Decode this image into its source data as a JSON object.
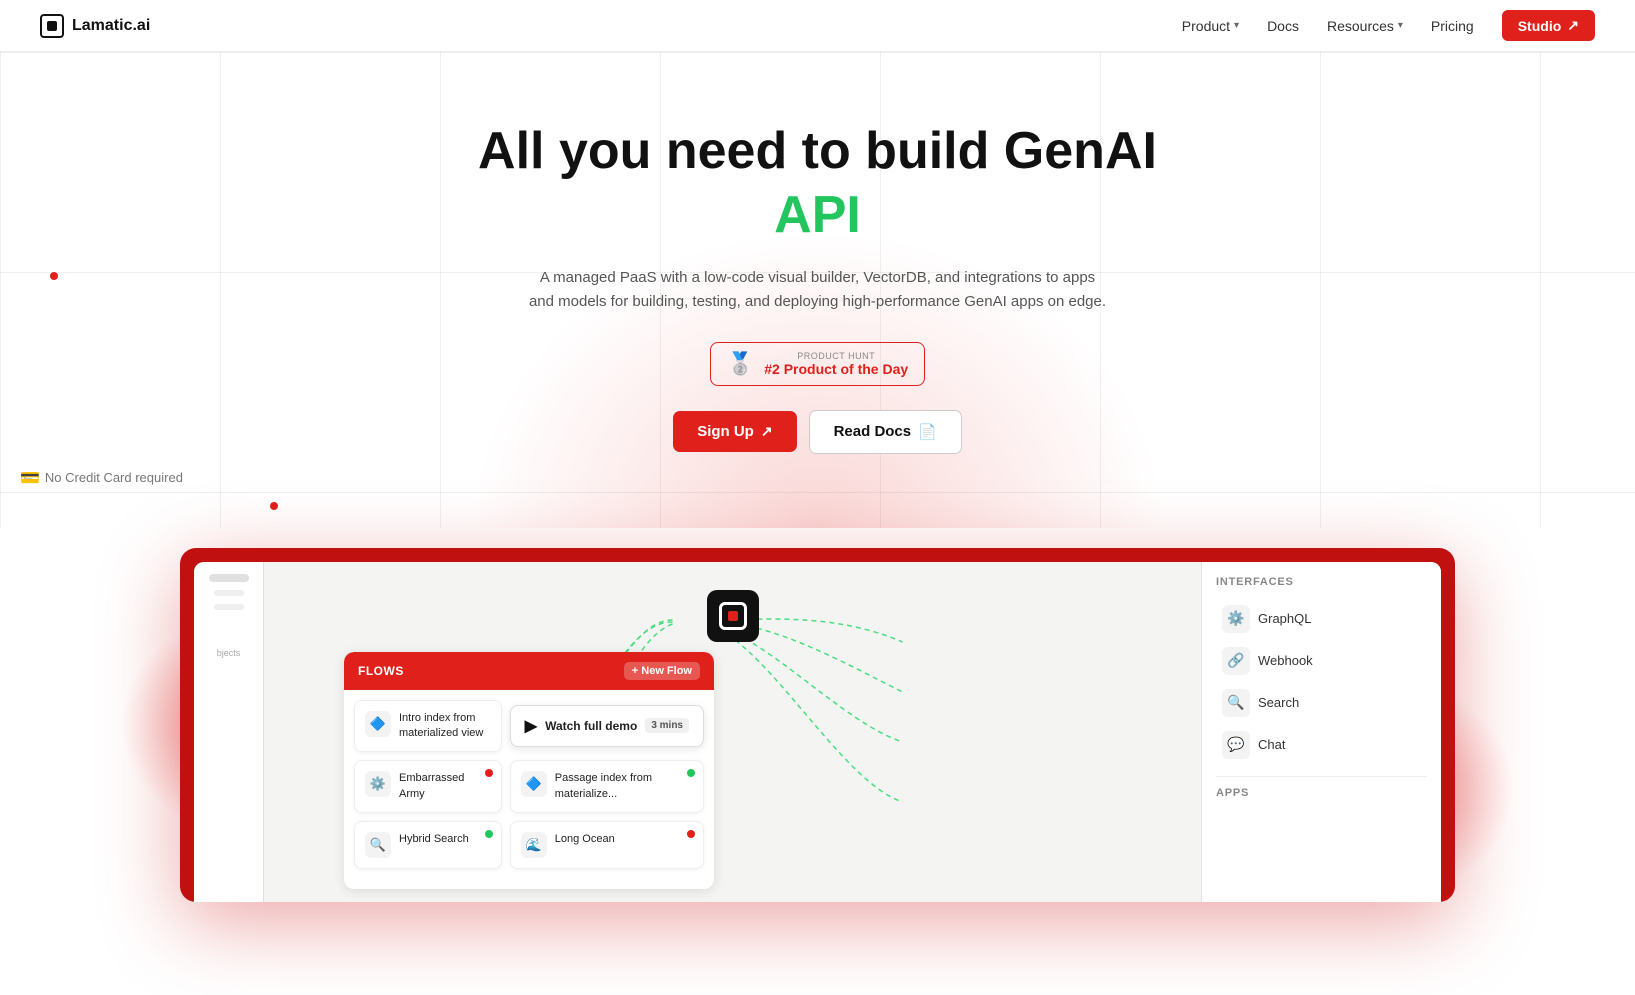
{
  "nav": {
    "logo_text": "Lamatic.ai",
    "links": [
      {
        "label": "Product",
        "has_dropdown": true
      },
      {
        "label": "Docs",
        "has_dropdown": false
      },
      {
        "label": "Resources",
        "has_dropdown": true
      },
      {
        "label": "Pricing",
        "has_dropdown": false
      }
    ],
    "studio_label": "Studio",
    "studio_arrow": "↗"
  },
  "hero": {
    "title_line1": "All you need to build GenAI",
    "title_line2": "API",
    "subtitle": "A managed PaaS with a low-code visual builder, VectorDB, and integrations to apps and models for building, testing, and deploying high-performance GenAI apps on edge.",
    "ph_label_top": "PRODUCT HUNT",
    "ph_label_main": "#2 Product of the Day",
    "btn_signup": "Sign Up",
    "btn_read_docs": "Read Docs",
    "no_cc_text": "No Credit Card required"
  },
  "demo": {
    "flows_title": "FLOWS",
    "new_flow_label": "+ New Flow",
    "flows": [
      {
        "id": "flow1",
        "icon": "🔷",
        "text": "Intro index from materialized view",
        "dot": "none"
      },
      {
        "id": "flow2",
        "icon": "⚙️",
        "text": "Embarrassed Army",
        "dot": "red"
      },
      {
        "id": "flow3",
        "icon": "🔷",
        "text": "Passage index from materialize...",
        "dot": "green"
      },
      {
        "id": "flow4",
        "icon": "🔍",
        "text": "Hybrid Search",
        "dot": "green"
      },
      {
        "id": "flow5",
        "icon": "🌊",
        "text": "Long Ocean",
        "dot": "red"
      }
    ],
    "watch_demo_label": "Watch full demo",
    "watch_demo_duration": "3 mins",
    "interfaces_title": "INTERFACES",
    "interfaces": [
      {
        "icon": "⚙️",
        "label": "GraphQL"
      },
      {
        "icon": "🔗",
        "label": "Webhook"
      },
      {
        "icon": "🔍",
        "label": "Search"
      },
      {
        "icon": "💬",
        "label": "Chat"
      }
    ],
    "apps_title": "APPS"
  }
}
